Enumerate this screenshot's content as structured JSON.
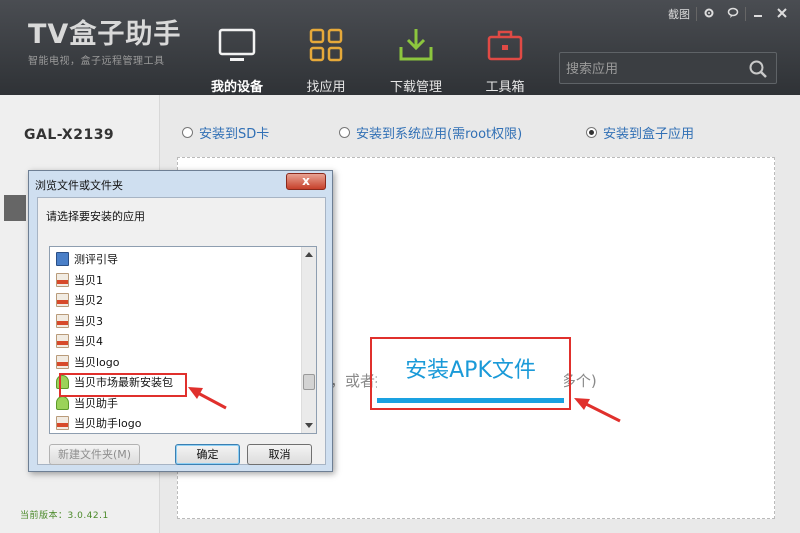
{
  "app": {
    "logo_title": "TV盒子助手",
    "logo_subtitle": "智能电视，盒子远程管理工具"
  },
  "window_controls": {
    "screenshot_label": "截图",
    "settings_icon": "gear-icon",
    "feedback_icon": "chat-bubble-icon",
    "minimize_icon": "minimize-icon",
    "close_icon": "close-icon"
  },
  "nav": {
    "items": [
      {
        "label": "我的设备",
        "icon": "tv-device-icon",
        "active": true
      },
      {
        "label": "找应用",
        "icon": "grid-apps-icon",
        "active": false
      },
      {
        "label": "下载管理",
        "icon": "download-tray-icon",
        "active": false
      },
      {
        "label": "工具箱",
        "icon": "toolbox-icon",
        "active": false
      }
    ]
  },
  "search": {
    "placeholder": "搜索应用",
    "icon": "search-icon"
  },
  "sidebar": {
    "device_name": "GAL-X2139",
    "version_text": "当前版本：3.0.42.1"
  },
  "install_options": [
    {
      "label": "安装到SD卡",
      "selected": false
    },
    {
      "label": "安装到系统应用(需root权限)",
      "selected": false
    },
    {
      "label": "安装到盒子应用",
      "selected": true
    }
  ],
  "drop_area": {
    "install_button_label": "安装APK文件",
    "hint_text": "传，或者拖拽文件到这里(可同时拖拽多个)"
  },
  "dialog": {
    "title": "浏览文件或文件夹",
    "close_label": "x",
    "prompt": "请选择要安装的应用",
    "items": [
      {
        "label": "测评引导",
        "icon": "exe"
      },
      {
        "label": "当贝1",
        "icon": "png"
      },
      {
        "label": "当贝2",
        "icon": "png"
      },
      {
        "label": "当贝3",
        "icon": "png"
      },
      {
        "label": "当贝4",
        "icon": "png"
      },
      {
        "label": "当贝logo",
        "icon": "png"
      },
      {
        "label": "当贝市场最新安装包",
        "icon": "apk"
      },
      {
        "label": "当贝助手",
        "icon": "apk"
      },
      {
        "label": "当贝助手logo",
        "icon": "png"
      }
    ],
    "new_folder_label": "新建文件夹(M)",
    "ok_label": "确定",
    "cancel_label": "取消"
  },
  "colors": {
    "highlight_red": "#e0302c",
    "accent_blue": "#1a9ad8",
    "radio_text_blue": "#3170b5"
  }
}
